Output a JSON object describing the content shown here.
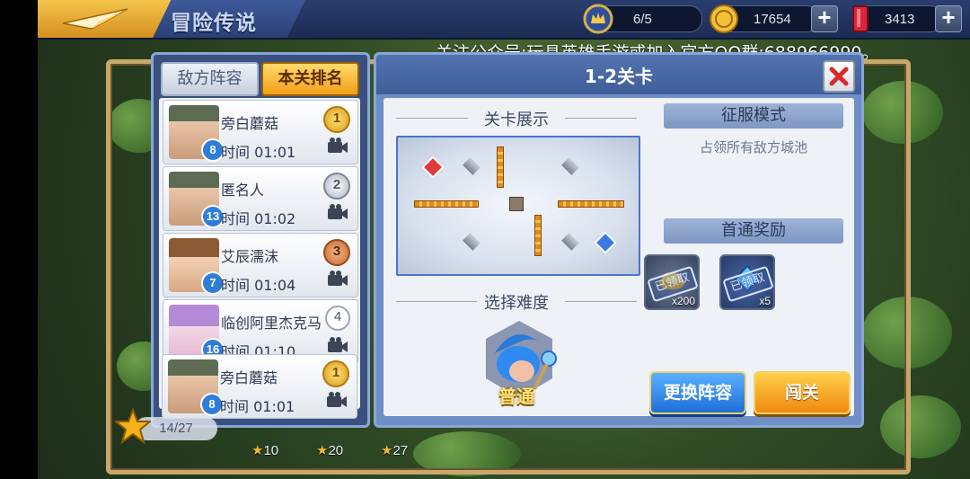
{
  "header": {
    "title": "冒险传说",
    "stamina": "6/5",
    "gold": "17654",
    "gems": "3413"
  },
  "announcement": "关注公众号:玩具英雄手游或加入官方QQ群:688966990。",
  "left_panel": {
    "tabs": [
      {
        "label": "敌方阵容",
        "active": false
      },
      {
        "label": "本关排名",
        "active": true
      }
    ],
    "ranking": [
      {
        "rank": "1",
        "name": "旁白蘑菇",
        "level": "8",
        "time": "时间 01:01",
        "medal": "gold"
      },
      {
        "rank": "2",
        "name": "匿名人",
        "level": "13",
        "time": "时间 01:02",
        "medal": "silver"
      },
      {
        "rank": "3",
        "name": "艾辰濡沫",
        "level": "7",
        "time": "时间 01:04",
        "medal": "bronze"
      },
      {
        "rank": "4",
        "name": "临创阿里杰克马",
        "level": "16",
        "time": "时间 01:10",
        "medal": "plain"
      }
    ],
    "mine": {
      "rank": "1",
      "name": "旁白蘑菇",
      "level": "8",
      "time": "时间 01:01"
    }
  },
  "right_panel": {
    "title": "1-2关卡",
    "preview_title": "关卡展示",
    "mode_title": "征服模式",
    "mode_desc": "占领所有敌方城池",
    "reward_title": "首通奖励",
    "rewards": [
      {
        "qty": "x200",
        "claimed_label": "已领取",
        "type": "gold"
      },
      {
        "qty": "x5",
        "claimed_label": "已领取",
        "type": "crystal"
      }
    ],
    "difficulty_title": "选择难度",
    "difficulty": "普通",
    "buttons": {
      "change": "更换阵容",
      "go": "闯关"
    }
  },
  "bottom": {
    "progress": "14/27",
    "stars": [
      "10",
      "20",
      "27"
    ]
  },
  "colors": {
    "accent_gold": "#f2a01a",
    "panel_blue": "#3a517f",
    "button_blue": "#1f6fd8"
  }
}
